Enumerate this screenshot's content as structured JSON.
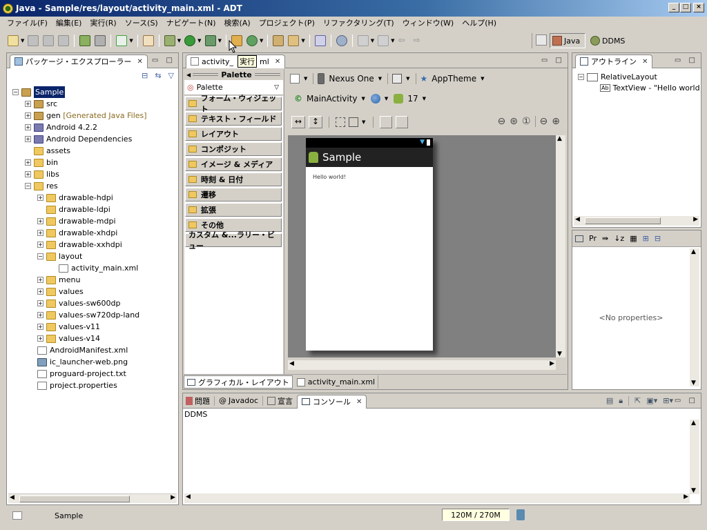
{
  "window": {
    "title": "Java - Sample/res/layout/activity_main.xml - ADT"
  },
  "menu": [
    "ファイル(F)",
    "編集(E)",
    "実行(R)",
    "ソース(S)",
    "ナビゲート(N)",
    "検索(A)",
    "プロジェクト(P)",
    "リファクタリング(T)",
    "ウィンドウ(W)",
    "ヘルプ(H)"
  ],
  "tooltip": "実行",
  "perspectives": {
    "java": "Java",
    "ddms": "DDMS"
  },
  "explorer": {
    "title": "パッケージ・エクスプローラー",
    "project": "Sample",
    "items": [
      {
        "label": "src",
        "icon": "package-folder-icon"
      },
      {
        "label": "gen",
        "extra": "[Generated Java Files]",
        "icon": "package-folder-icon"
      },
      {
        "label": "Android 4.2.2",
        "icon": "library-icon"
      },
      {
        "label": "Android Dependencies",
        "icon": "library-icon"
      },
      {
        "label": "assets",
        "icon": "folder-icon"
      },
      {
        "label": "bin",
        "icon": "folder-icon"
      },
      {
        "label": "libs",
        "icon": "folder-icon"
      },
      {
        "label": "res",
        "icon": "folder-icon"
      },
      {
        "label": "drawable-hdpi",
        "icon": "folder-icon"
      },
      {
        "label": "drawable-ldpi",
        "icon": "folder-icon"
      },
      {
        "label": "drawable-mdpi",
        "icon": "folder-icon"
      },
      {
        "label": "drawable-xhdpi",
        "icon": "folder-icon"
      },
      {
        "label": "drawable-xxhdpi",
        "icon": "folder-icon"
      },
      {
        "label": "layout",
        "icon": "folder-icon"
      },
      {
        "label": "activity_main.xml",
        "icon": "xml-file-icon"
      },
      {
        "label": "menu",
        "icon": "folder-icon"
      },
      {
        "label": "values",
        "icon": "folder-icon"
      },
      {
        "label": "values-sw600dp",
        "icon": "folder-icon"
      },
      {
        "label": "values-sw720dp-land",
        "icon": "folder-icon"
      },
      {
        "label": "values-v11",
        "icon": "folder-icon"
      },
      {
        "label": "values-v14",
        "icon": "folder-icon"
      },
      {
        "label": "AndroidManifest.xml",
        "icon": "xml-file-icon"
      },
      {
        "label": "ic_launcher-web.png",
        "icon": "image-file-icon"
      },
      {
        "label": "proguard-project.txt",
        "icon": "text-file-icon"
      },
      {
        "label": "project.properties",
        "icon": "text-file-icon"
      }
    ]
  },
  "editor": {
    "tab": "activity_main.xml",
    "tab_visible": "activity_",
    "tab_rest": "ml",
    "palette_header": "Palette",
    "palette_dropdown": "Palette",
    "palette_categories": [
      "フォーム・ウィジェット",
      "テキスト・フィールド",
      "レイアウト",
      "コンポジット",
      "イメージ & メディア",
      "時刻 & 日付",
      "遷移",
      "拡張",
      "その他"
    ],
    "palette_custom": "カスタム &...ラリー・ビュー",
    "device": "Nexus One",
    "theme": "AppTheme",
    "activity": "MainActivity",
    "api": "17",
    "app_title": "Sample",
    "hello": "Hello world!",
    "bottom_tabs": [
      "グラフィカル・レイアウト",
      "activity_main.xml"
    ]
  },
  "outline": {
    "title": "アウトライン",
    "root": "RelativeLayout",
    "child": "TextView - \"Hello world"
  },
  "properties": {
    "empty": "<No properties>",
    "tab": "Pr"
  },
  "console": {
    "tabs": [
      "問題",
      "Javadoc",
      "宣言",
      "コンソール"
    ],
    "content": "DDMS"
  },
  "status": {
    "selection": "Sample",
    "heap": "120M / 270M"
  }
}
